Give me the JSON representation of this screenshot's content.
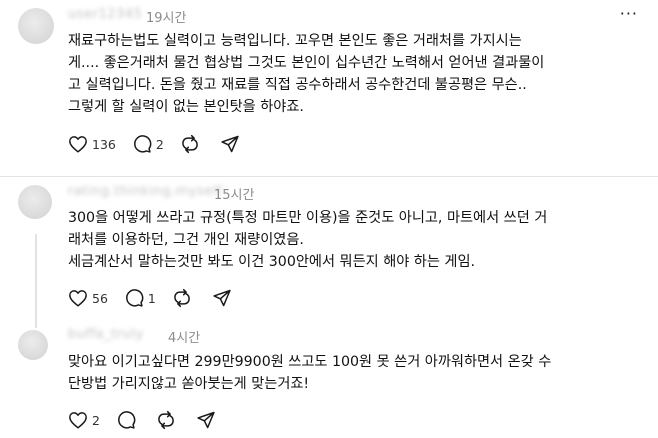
{
  "posts": [
    {
      "username": "user12345",
      "time": "19시간",
      "more": "···",
      "text": "재료구하는법도 실력이고 능력입니다. 꼬우면 본인도 좋은 거래처를 가지시는\n게.... 좋은거래처 물건 협상법 그것도 본인이 십수년간 노력해서 얻어낸 결과물이\n고 실력입니다. 돈을 줬고 재료를 직접 공수하래서 공수한건데 불공평은 무슨..\n그렇게 할 실력이 없는 본인탓을 하야죠.",
      "likes": "136",
      "replies": "2",
      "reposts": "",
      "shares": ""
    },
    {
      "username": "rating.thinking.myself",
      "time": "15시간",
      "more": "",
      "text": "300을 어떻게 쓰라고 규정(특정 마트만 이용)을 준것도 아니고, 마트에서 쓰던 거\n래처를 이용하던, 그건 개인 재량이였음.\n세금계산서 말하는것만 봐도 이건 300안에서 뭐든지 해야 하는 게임.",
      "likes": "56",
      "replies": "1",
      "reposts": "",
      "shares": ""
    },
    {
      "username": "buffa_truly",
      "time": "4시간",
      "more": "",
      "text": "맞아요 이기고싶다면 299만9900원 쓰고도 100원 못 쓴거 아까워하면서 온갖 수\n단방법 가리지않고 쏟아붓는게 맞는거죠!",
      "likes": "2",
      "replies": "",
      "reposts": "",
      "shares": ""
    }
  ]
}
